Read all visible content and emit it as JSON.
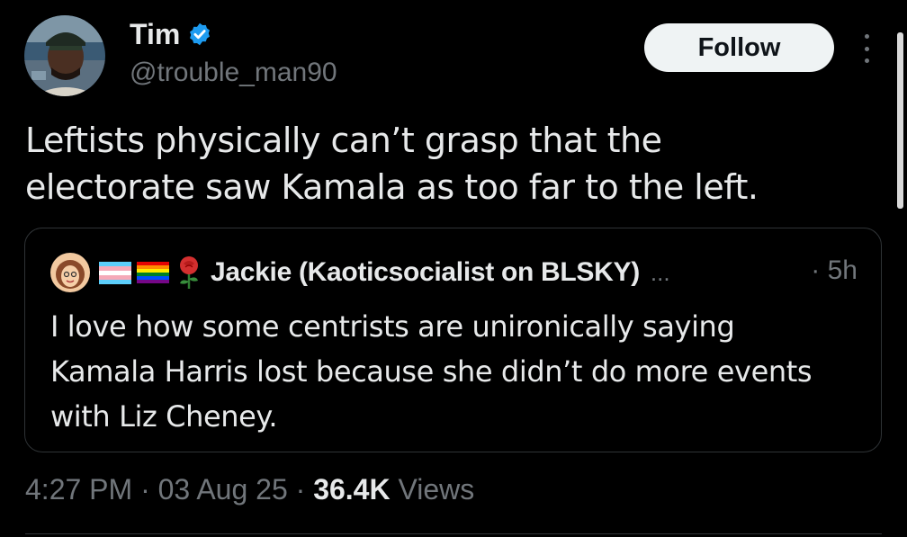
{
  "author": {
    "display_name": "Tim",
    "handle": "@trouble_man90",
    "verified_icon": "verified-badge-icon",
    "avatar": "avatar"
  },
  "actions": {
    "follow_label": "Follow",
    "more_icon": "more-options-icon"
  },
  "tweet": {
    "line1": "Leftists physically can’t grasp that the",
    "line2": "electorate saw Kamala as too far to the left."
  },
  "quote": {
    "display_name": "Jackie (Kaoticsocialist on BLSKY)",
    "ellipsis": "...",
    "time": "· 5h",
    "emojis": [
      "transgender-flag-icon",
      "rainbow-flag-icon",
      "rose-icon"
    ],
    "line1": "I love how some centrists are unironically saying",
    "line2": "Kamala Harris lost because she didn’t do more events",
    "line3": "with Liz Cheney."
  },
  "meta": {
    "time": "4:27 PM",
    "sep1": " · ",
    "date": "03 Aug 25",
    "sep2": " · ",
    "views_count": "36.4K",
    "views_label": " Views"
  },
  "colors": {
    "background": "#000000",
    "text": "#e7e9ea",
    "secondary": "#71767b",
    "verified": "#1d9bf0",
    "follow_bg": "#eff3f4",
    "border": "#2f3336"
  }
}
